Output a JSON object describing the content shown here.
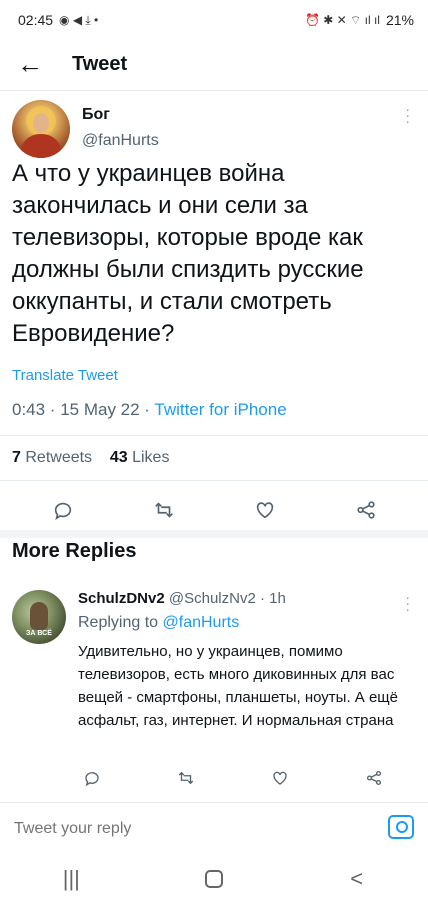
{
  "status": {
    "time": "02:45",
    "battery": "21%"
  },
  "header": {
    "title": "Tweet"
  },
  "tweet": {
    "name": "Бог",
    "handle": "@fanHurts",
    "text": "А что у украинцев война закончилась и они сели за телевизоры, которые вроде как должны были спиздить русские оккупанты, и стали смотреть Евровидение?",
    "translate_label": "Translate Tweet",
    "timestamp": "0:43 · 15 May 22 ·",
    "source": "Twitter for iPhone",
    "retweets_count": "7",
    "retweets_label": "Retweets",
    "likes_count": "43",
    "likes_label": "Likes"
  },
  "more_replies": {
    "title": "More Replies"
  },
  "reply": {
    "name": "SchulzDNv2",
    "handle": "@SchulzNv2 · 1h",
    "replying_prefix": "Replying to",
    "replying_to": "@fanHurts",
    "text": "Удивительно, но у украинцев, помимо телевизоров, есть много диковинных для вас вещей - смартфоны, планшеты, ноуты. А ещё асфальт, газ, интернет. И нормальная страна"
  },
  "compose": {
    "placeholder": "Tweet your reply"
  },
  "colors": {
    "accent": "#1d9bf0",
    "muted": "#536471",
    "text": "#0f1419"
  },
  "icons": [
    "back-arrow-icon",
    "more-icon",
    "reply-icon",
    "retweet-icon",
    "like-icon",
    "share-icon",
    "camera-icon",
    "recents-icon",
    "home-icon",
    "back-icon"
  ]
}
